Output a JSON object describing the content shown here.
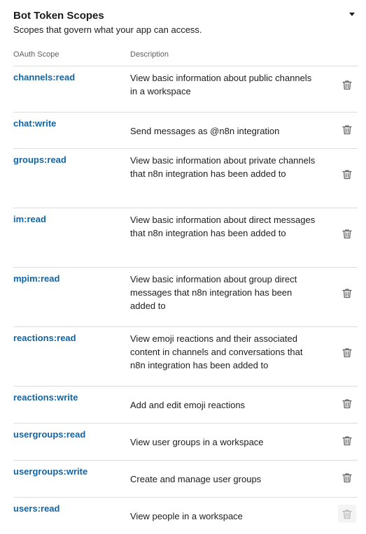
{
  "section": {
    "title": "Bot Token Scopes",
    "subtitle": "Scopes that govern what your app can access."
  },
  "table": {
    "headers": {
      "scope": "OAuth Scope",
      "description": "Description"
    },
    "rows": [
      {
        "scope": "channels:read",
        "description": "View basic information about public channels in a workspace"
      },
      {
        "scope": "chat:write",
        "description": "Send messages as @n8n integration"
      },
      {
        "scope": "groups:read",
        "description": "View basic information about private channels that n8n integration has been added to"
      },
      {
        "scope": "im:read",
        "description": "View basic information about direct messages that n8n integration has been added to"
      },
      {
        "scope": "mpim:read",
        "description": "View basic information about group direct messages that n8n integration has been added to"
      },
      {
        "scope": "reactions:read",
        "description": "View emoji reactions and their associated content in channels and conversations that n8n integration has been added to"
      },
      {
        "scope": "reactions:write",
        "description": "Add and edit emoji reactions"
      },
      {
        "scope": "usergroups:read",
        "description": "View user groups in a workspace"
      },
      {
        "scope": "usergroups:write",
        "description": "Create and manage user groups"
      },
      {
        "scope": "users:read",
        "description": "View people in a workspace"
      }
    ]
  },
  "icons": {
    "collapse": "caret-down-icon",
    "delete": "trash-icon"
  },
  "colors": {
    "link": "#1264a3",
    "text": "#1d1c1d",
    "muted": "#616061",
    "divider": "#dddddd"
  }
}
